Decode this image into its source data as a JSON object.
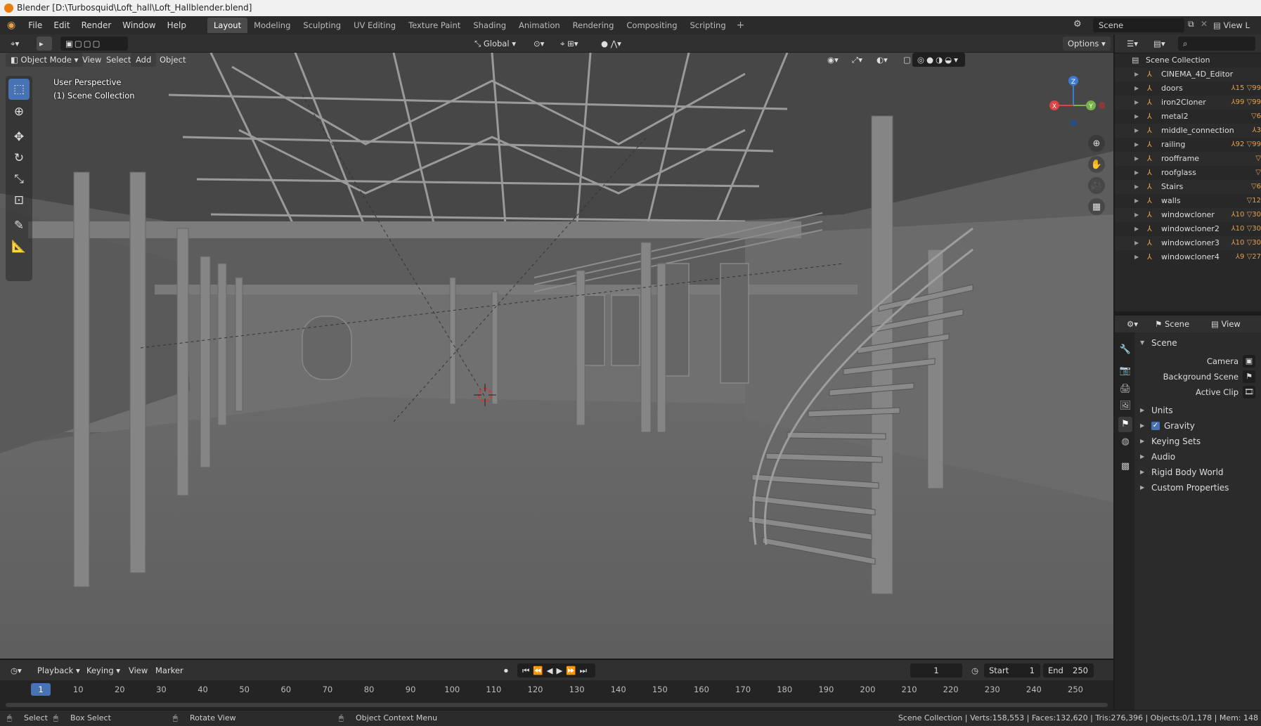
{
  "window": {
    "title": "Blender [D:\\Turbosquid\\Loft_hall\\Loft_Hallblender.blend]"
  },
  "menu": [
    "File",
    "Edit",
    "Render",
    "Window",
    "Help"
  ],
  "workspaces": [
    "Layout",
    "Modeling",
    "Sculpting",
    "UV Editing",
    "Texture Paint",
    "Shading",
    "Animation",
    "Rendering",
    "Compositing",
    "Scripting"
  ],
  "active_workspace": "Layout",
  "topbar": {
    "scene": "Scene",
    "view_layer": "View L"
  },
  "viewport": {
    "mode": "Object Mode",
    "menus": [
      "View",
      "Select",
      "Add",
      "Object"
    ],
    "transform_orientation": "Global",
    "options": "Options",
    "perspective": "User Perspective",
    "collection": "(1) Scene Collection",
    "gizmo_axes": {
      "x": "X",
      "y": "Y",
      "z": "Z"
    }
  },
  "outliner": {
    "root": "Scene Collection",
    "items": [
      {
        "name": "CINEMA_4D_Editor",
        "badge": ""
      },
      {
        "name": "doors",
        "badge": "⅄15 ▽99"
      },
      {
        "name": "iron2Cloner",
        "badge": "⅄99 ▽99"
      },
      {
        "name": "metal2",
        "badge": "▽6"
      },
      {
        "name": "middle_connection",
        "badge": "⅄3"
      },
      {
        "name": "railing",
        "badge": "⅄92 ▽99"
      },
      {
        "name": "roofframe",
        "badge": "▽"
      },
      {
        "name": "roofglass",
        "badge": "▽"
      },
      {
        "name": "Stairs",
        "badge": "▽6"
      },
      {
        "name": "walls",
        "badge": "▽12"
      },
      {
        "name": "windowcloner",
        "badge": "⅄10 ▽30"
      },
      {
        "name": "windowcloner2",
        "badge": "⅄10 ▽30"
      },
      {
        "name": "windowcloner3",
        "badge": "⅄10 ▽30"
      },
      {
        "name": "windowcloner4",
        "badge": "⅄9 ▽27"
      }
    ]
  },
  "properties": {
    "header_scene": "Scene",
    "header_view_layer": "View Lay",
    "panel": "Scene",
    "fields": [
      {
        "label": "Camera"
      },
      {
        "label": "Background Scene"
      },
      {
        "label": "Active Clip"
      }
    ],
    "sections": [
      "Units",
      "Gravity",
      "Keying Sets",
      "Audio",
      "Rigid Body World",
      "Custom Properties"
    ]
  },
  "timeline": {
    "menus": [
      "Playback",
      "Keying",
      "View",
      "Marker"
    ],
    "current_frame": "1",
    "start_label": "Start",
    "start": "1",
    "end_label": "End",
    "end": "250",
    "ticks": [
      "1",
      "10",
      "20",
      "30",
      "40",
      "50",
      "60",
      "70",
      "80",
      "90",
      "100",
      "110",
      "120",
      "130",
      "140",
      "150",
      "160",
      "170",
      "180",
      "190",
      "200",
      "210",
      "220",
      "230",
      "240",
      "250"
    ]
  },
  "statusbar": {
    "select": "Select",
    "box_select": "Box Select",
    "rotate_view": "Rotate View",
    "context_menu": "Object Context Menu",
    "stats": "Scene Collection | Verts:158,553 | Faces:132,620 | Tris:276,396 | Objects:0/1,178 | Mem: 148"
  },
  "colors": {
    "accent": "#4772b3",
    "viewport_bg": "#5d5d5d",
    "object_orange": "#e8a04a"
  }
}
